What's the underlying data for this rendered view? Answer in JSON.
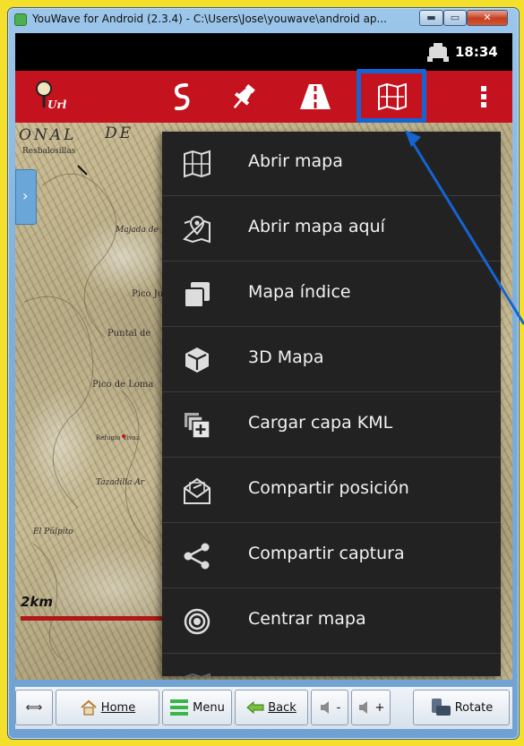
{
  "window": {
    "title": "YouWave for Android (2.3.4) - C:\\Users\\Jose\\youwave\\android ap...",
    "min_label": "▬",
    "max_label": "▭",
    "close_label": "✕"
  },
  "status": {
    "time": "18:34"
  },
  "actionbar": {
    "items": [
      {
        "icon": "map-url-pin-icon",
        "label": "Url"
      },
      {
        "icon": "route-icon"
      },
      {
        "icon": "pushpin-icon"
      },
      {
        "icon": "road-icon"
      },
      {
        "icon": "map-folded-icon"
      },
      {
        "icon": "overflow-menu-icon"
      }
    ],
    "highlight_color": "#1564d2"
  },
  "map": {
    "labels": [
      "ONAL",
      "DE",
      "Resbalosillas",
      "Majada de",
      "Pico Ju",
      "Puntal de",
      "Pico de Loma",
      "Refugio Vivaz",
      "Tazadilla Ar",
      "El Púlpito"
    ],
    "scale_label": "2km"
  },
  "menu": {
    "items": [
      {
        "icon": "map-icon",
        "label": "Abrir mapa"
      },
      {
        "icon": "map-pin-icon",
        "label": "Abrir mapa aquí"
      },
      {
        "icon": "layers-icon",
        "label": "Mapa índice"
      },
      {
        "icon": "cube-icon",
        "label": "3D Mapa"
      },
      {
        "icon": "kml-layer-icon",
        "label": "Cargar capa KML"
      },
      {
        "icon": "share-position-icon",
        "label": "Compartir posición"
      },
      {
        "icon": "share-icon",
        "label": "Compartir captura"
      },
      {
        "icon": "target-icon",
        "label": "Centrar mapa"
      },
      {
        "icon": "map-icon",
        "label": "..."
      }
    ]
  },
  "toolbar": {
    "arrows_label": "⟺",
    "home_label": "Home",
    "menu_label": "Menu",
    "back_label": "Back",
    "vol_down_label": "-",
    "vol_up_label": "+",
    "rotate_label": "Rotate"
  },
  "colors": {
    "actionbar": "#c4121e",
    "menu_bg": "#222222",
    "annotation": "#1564d2",
    "desktop": "#f4df2a"
  }
}
